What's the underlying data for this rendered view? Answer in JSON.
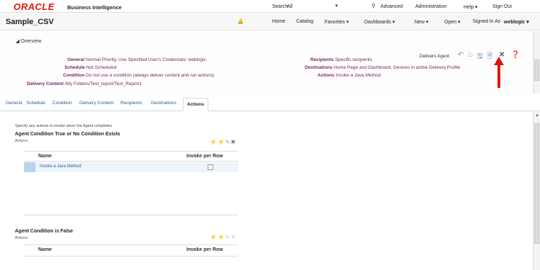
{
  "brand": {
    "logo": "ORACLE",
    "product": "Business Intelligence"
  },
  "topnav": {
    "search_label": "Search",
    "search_scope": "All",
    "advanced": "Advanced",
    "administration": "Administration",
    "help": "Help ▾",
    "signout": "Sign Out"
  },
  "header": {
    "title": "Sample_CSV",
    "home": "Home",
    "catalog": "Catalog",
    "favorites": "Favorites ▾",
    "dashboards": "Dashboards ▾",
    "new": "New ▾",
    "open": "Open ▾",
    "signed_in_as": "Signed In As",
    "user": "weblogic ▾"
  },
  "overview": {
    "toggle": "◢ Overview",
    "left": [
      {
        "key": "General",
        "value": "Normal Priority, Use Specified User's Credentials: weblogic"
      },
      {
        "key": "Schedule",
        "value": "Not Scheduled"
      },
      {
        "key": "Condition",
        "value": "Do not use a condition (always deliver content and run actions)"
      },
      {
        "key": "Delivery Content",
        "value": "/My Folders/Test_report/Test_Report1"
      }
    ],
    "right": [
      {
        "key": "Recipients",
        "value": "Specific recipients"
      },
      {
        "key": "Destinations",
        "value": "Home Page and Dashboard, Devices in active Delivery Profile"
      },
      {
        "key": "Actions",
        "value": "Invoke a Java Method"
      }
    ],
    "delivers_agent": "Delivers Agent"
  },
  "tabs": [
    "General",
    "Schedule",
    "Condition",
    "Delivery Content",
    "Recipients",
    "Destinations",
    "Actions"
  ],
  "active_tab": "Actions",
  "actions": {
    "hint": "Specify any actions to invoke when the Agent completes.",
    "true_section": {
      "title": "Agent Condition True or No Condition Exists",
      "subtitle": "Actions",
      "col_name": "Name",
      "col_invoke": "Invoke per Row",
      "rows": [
        {
          "name": "Invoke a Java Method"
        }
      ]
    },
    "false_section": {
      "title": "Agent Condition is False",
      "subtitle": "Actions",
      "col_name": "Name",
      "col_invoke": "Invoke per Row"
    }
  },
  "colors": {
    "oracle_red": "#e3120b",
    "label_purple": "#7a1f5c",
    "link_blue": "#2a5b9c",
    "selection": "#b9d3ee"
  }
}
